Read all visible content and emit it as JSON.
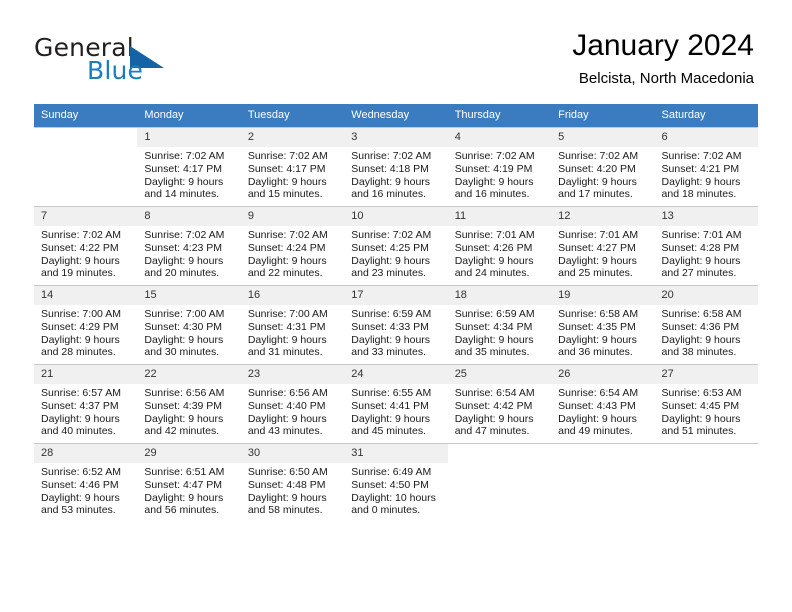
{
  "brand": {
    "word1": "General",
    "word2": "Blue",
    "triangle_color": "#1464a5",
    "blue_color": "#1a7dc4"
  },
  "header": {
    "title": "January 2024",
    "subtitle": "Belcista, North Macedonia"
  },
  "theme": {
    "header_row_bg": "#3a7cbf",
    "daynum_bg": "#f0f0f0",
    "grid_line": "#c8c8c8"
  },
  "weekday_headers": [
    "Sunday",
    "Monday",
    "Tuesday",
    "Wednesday",
    "Thursday",
    "Friday",
    "Saturday"
  ],
  "weeks": [
    [
      {
        "empty": true,
        "day": ""
      },
      {
        "day": "1",
        "sunrise": "Sunrise: 7:02 AM",
        "sunset": "Sunset: 4:17 PM",
        "daylight_line1": "Daylight: 9 hours",
        "daylight_line2": "and 14 minutes."
      },
      {
        "day": "2",
        "sunrise": "Sunrise: 7:02 AM",
        "sunset": "Sunset: 4:17 PM",
        "daylight_line1": "Daylight: 9 hours",
        "daylight_line2": "and 15 minutes."
      },
      {
        "day": "3",
        "sunrise": "Sunrise: 7:02 AM",
        "sunset": "Sunset: 4:18 PM",
        "daylight_line1": "Daylight: 9 hours",
        "daylight_line2": "and 16 minutes."
      },
      {
        "day": "4",
        "sunrise": "Sunrise: 7:02 AM",
        "sunset": "Sunset: 4:19 PM",
        "daylight_line1": "Daylight: 9 hours",
        "daylight_line2": "and 16 minutes."
      },
      {
        "day": "5",
        "sunrise": "Sunrise: 7:02 AM",
        "sunset": "Sunset: 4:20 PM",
        "daylight_line1": "Daylight: 9 hours",
        "daylight_line2": "and 17 minutes."
      },
      {
        "day": "6",
        "sunrise": "Sunrise: 7:02 AM",
        "sunset": "Sunset: 4:21 PM",
        "daylight_line1": "Daylight: 9 hours",
        "daylight_line2": "and 18 minutes."
      }
    ],
    [
      {
        "day": "7",
        "sunrise": "Sunrise: 7:02 AM",
        "sunset": "Sunset: 4:22 PM",
        "daylight_line1": "Daylight: 9 hours",
        "daylight_line2": "and 19 minutes."
      },
      {
        "day": "8",
        "sunrise": "Sunrise: 7:02 AM",
        "sunset": "Sunset: 4:23 PM",
        "daylight_line1": "Daylight: 9 hours",
        "daylight_line2": "and 20 minutes."
      },
      {
        "day": "9",
        "sunrise": "Sunrise: 7:02 AM",
        "sunset": "Sunset: 4:24 PM",
        "daylight_line1": "Daylight: 9 hours",
        "daylight_line2": "and 22 minutes."
      },
      {
        "day": "10",
        "sunrise": "Sunrise: 7:02 AM",
        "sunset": "Sunset: 4:25 PM",
        "daylight_line1": "Daylight: 9 hours",
        "daylight_line2": "and 23 minutes."
      },
      {
        "day": "11",
        "sunrise": "Sunrise: 7:01 AM",
        "sunset": "Sunset: 4:26 PM",
        "daylight_line1": "Daylight: 9 hours",
        "daylight_line2": "and 24 minutes."
      },
      {
        "day": "12",
        "sunrise": "Sunrise: 7:01 AM",
        "sunset": "Sunset: 4:27 PM",
        "daylight_line1": "Daylight: 9 hours",
        "daylight_line2": "and 25 minutes."
      },
      {
        "day": "13",
        "sunrise": "Sunrise: 7:01 AM",
        "sunset": "Sunset: 4:28 PM",
        "daylight_line1": "Daylight: 9 hours",
        "daylight_line2": "and 27 minutes."
      }
    ],
    [
      {
        "day": "14",
        "sunrise": "Sunrise: 7:00 AM",
        "sunset": "Sunset: 4:29 PM",
        "daylight_line1": "Daylight: 9 hours",
        "daylight_line2": "and 28 minutes."
      },
      {
        "day": "15",
        "sunrise": "Sunrise: 7:00 AM",
        "sunset": "Sunset: 4:30 PM",
        "daylight_line1": "Daylight: 9 hours",
        "daylight_line2": "and 30 minutes."
      },
      {
        "day": "16",
        "sunrise": "Sunrise: 7:00 AM",
        "sunset": "Sunset: 4:31 PM",
        "daylight_line1": "Daylight: 9 hours",
        "daylight_line2": "and 31 minutes."
      },
      {
        "day": "17",
        "sunrise": "Sunrise: 6:59 AM",
        "sunset": "Sunset: 4:33 PM",
        "daylight_line1": "Daylight: 9 hours",
        "daylight_line2": "and 33 minutes."
      },
      {
        "day": "18",
        "sunrise": "Sunrise: 6:59 AM",
        "sunset": "Sunset: 4:34 PM",
        "daylight_line1": "Daylight: 9 hours",
        "daylight_line2": "and 35 minutes."
      },
      {
        "day": "19",
        "sunrise": "Sunrise: 6:58 AM",
        "sunset": "Sunset: 4:35 PM",
        "daylight_line1": "Daylight: 9 hours",
        "daylight_line2": "and 36 minutes."
      },
      {
        "day": "20",
        "sunrise": "Sunrise: 6:58 AM",
        "sunset": "Sunset: 4:36 PM",
        "daylight_line1": "Daylight: 9 hours",
        "daylight_line2": "and 38 minutes."
      }
    ],
    [
      {
        "day": "21",
        "sunrise": "Sunrise: 6:57 AM",
        "sunset": "Sunset: 4:37 PM",
        "daylight_line1": "Daylight: 9 hours",
        "daylight_line2": "and 40 minutes."
      },
      {
        "day": "22",
        "sunrise": "Sunrise: 6:56 AM",
        "sunset": "Sunset: 4:39 PM",
        "daylight_line1": "Daylight: 9 hours",
        "daylight_line2": "and 42 minutes."
      },
      {
        "day": "23",
        "sunrise": "Sunrise: 6:56 AM",
        "sunset": "Sunset: 4:40 PM",
        "daylight_line1": "Daylight: 9 hours",
        "daylight_line2": "and 43 minutes."
      },
      {
        "day": "24",
        "sunrise": "Sunrise: 6:55 AM",
        "sunset": "Sunset: 4:41 PM",
        "daylight_line1": "Daylight: 9 hours",
        "daylight_line2": "and 45 minutes."
      },
      {
        "day": "25",
        "sunrise": "Sunrise: 6:54 AM",
        "sunset": "Sunset: 4:42 PM",
        "daylight_line1": "Daylight: 9 hours",
        "daylight_line2": "and 47 minutes."
      },
      {
        "day": "26",
        "sunrise": "Sunrise: 6:54 AM",
        "sunset": "Sunset: 4:43 PM",
        "daylight_line1": "Daylight: 9 hours",
        "daylight_line2": "and 49 minutes."
      },
      {
        "day": "27",
        "sunrise": "Sunrise: 6:53 AM",
        "sunset": "Sunset: 4:45 PM",
        "daylight_line1": "Daylight: 9 hours",
        "daylight_line2": "and 51 minutes."
      }
    ],
    [
      {
        "day": "28",
        "sunrise": "Sunrise: 6:52 AM",
        "sunset": "Sunset: 4:46 PM",
        "daylight_line1": "Daylight: 9 hours",
        "daylight_line2": "and 53 minutes."
      },
      {
        "day": "29",
        "sunrise": "Sunrise: 6:51 AM",
        "sunset": "Sunset: 4:47 PM",
        "daylight_line1": "Daylight: 9 hours",
        "daylight_line2": "and 56 minutes."
      },
      {
        "day": "30",
        "sunrise": "Sunrise: 6:50 AM",
        "sunset": "Sunset: 4:48 PM",
        "daylight_line1": "Daylight: 9 hours",
        "daylight_line2": "and 58 minutes."
      },
      {
        "day": "31",
        "sunrise": "Sunrise: 6:49 AM",
        "sunset": "Sunset: 4:50 PM",
        "daylight_line1": "Daylight: 10 hours",
        "daylight_line2": "and 0 minutes."
      },
      {
        "empty": true,
        "day": ""
      },
      {
        "empty": true,
        "day": ""
      },
      {
        "empty": true,
        "day": ""
      }
    ]
  ]
}
